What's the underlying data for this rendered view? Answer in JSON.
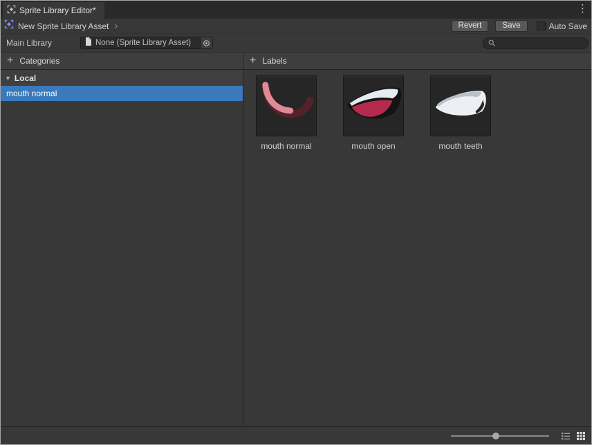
{
  "window": {
    "tab_title": "Sprite Library Editor*",
    "menu_icon_glyph": "⋮"
  },
  "toolbar": {
    "breadcrumb": "New Sprite Library Asset",
    "separator_glyph": "›",
    "revert_label": "Revert",
    "save_label": "Save",
    "auto_save_label": "Auto Save",
    "auto_save_checked": false
  },
  "library_bar": {
    "label": "Main Library",
    "object_value": "None (Sprite Library Asset)",
    "search_placeholder": ""
  },
  "categories_pane": {
    "header": "Categories",
    "add_glyph": "+",
    "group": {
      "label": "Local",
      "foldout_glyph": "▼",
      "items": [
        {
          "label": "mouth normal",
          "selected": true
        }
      ]
    }
  },
  "labels_pane": {
    "header": "Labels",
    "add_glyph": "+",
    "items": [
      {
        "label": "mouth normal"
      },
      {
        "label": "mouth open"
      },
      {
        "label": "mouth teeth"
      }
    ]
  },
  "bottom_bar": {
    "slider_value": 0.42,
    "active_view": "grid"
  },
  "colors": {
    "selection_blue": "#3a79bb",
    "sprite_pink": "#e08a96",
    "sprite_maroon": "#54222c",
    "sprite_crimson": "#b52b50",
    "sprite_white": "#e9edf2"
  }
}
